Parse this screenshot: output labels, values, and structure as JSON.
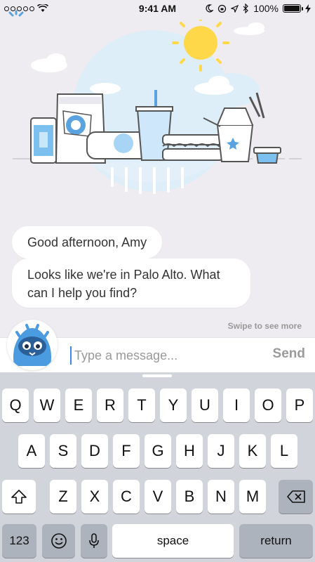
{
  "status_bar": {
    "time": "9:41 AM",
    "battery": "100%",
    "battery_level": 1.0
  },
  "chat": {
    "messages": [
      "Good afternoon, Amy",
      "Looks like we're in Palo Alto. What can I help you find?"
    ],
    "swipe_hint": "Swipe to see more"
  },
  "composer": {
    "placeholder": "Type a message...",
    "send_label": "Send"
  },
  "keyboard": {
    "row1": [
      "Q",
      "W",
      "E",
      "R",
      "T",
      "Y",
      "U",
      "I",
      "O",
      "P"
    ],
    "row2": [
      "A",
      "S",
      "D",
      "F",
      "G",
      "H",
      "J",
      "K",
      "L"
    ],
    "row3": [
      "Z",
      "X",
      "C",
      "V",
      "B",
      "N",
      "M"
    ],
    "numbers_label": "123",
    "space_label": "space",
    "return_label": "return"
  },
  "colors": {
    "accent": "#3a8be6",
    "bubble": "#ffffff",
    "background": "#eeecf0",
    "keyboard": "#d1d4da"
  },
  "icons": [
    "wifi-icon",
    "moon-icon",
    "lock-rotation-icon",
    "location-icon",
    "bluetooth-icon",
    "charging-icon",
    "gear-icon",
    "shift-icon",
    "backspace-icon",
    "emoji-icon",
    "microphone-icon"
  ]
}
